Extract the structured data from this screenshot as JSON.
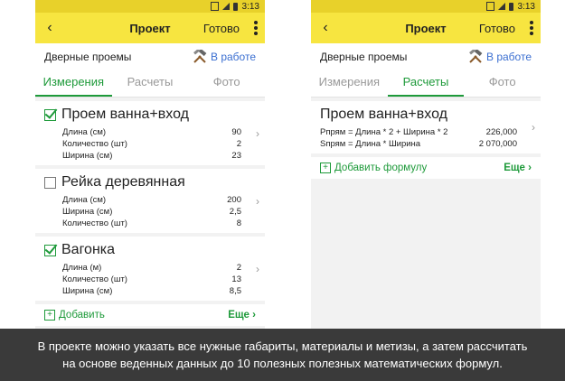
{
  "status_time": "3:13",
  "screens": [
    {
      "appbar": {
        "title": "Проект",
        "done_label": "Готово"
      },
      "subhead": {
        "project": "Дверные проемы",
        "status": "В работе"
      },
      "tabs": [
        {
          "label": "Измерения"
        },
        {
          "label": "Расчеты"
        },
        {
          "label": "Фото"
        }
      ],
      "active_tab": 0,
      "items": [
        {
          "title": "Проем ванна+вход",
          "checked": true,
          "rows": [
            {
              "label": "Длина (см)",
              "value": "90"
            },
            {
              "label": "Количество (шт)",
              "value": "2"
            },
            {
              "label": "Ширина (см)",
              "value": "23"
            }
          ]
        },
        {
          "title": "Рейка деревянная",
          "checked": false,
          "rows": [
            {
              "label": "Длина (см)",
              "value": "200"
            },
            {
              "label": "Ширина (см)",
              "value": "2,5"
            },
            {
              "label": "Количество (шт)",
              "value": "8"
            }
          ]
        },
        {
          "title": "Вагонка",
          "checked": true,
          "rows": [
            {
              "label": "Длина (м)",
              "value": "2"
            },
            {
              "label": "Количество (шт)",
              "value": "13"
            },
            {
              "label": "Ширина (см)",
              "value": "8,5"
            }
          ]
        }
      ],
      "footer": {
        "add_label": "Добавить",
        "more_label": "Еще"
      }
    },
    {
      "appbar": {
        "title": "Проект",
        "done_label": "Готово"
      },
      "subhead": {
        "project": "Дверные проемы",
        "status": "В работе"
      },
      "tabs": [
        {
          "label": "Измерения"
        },
        {
          "label": "Расчеты"
        },
        {
          "label": "Фото"
        }
      ],
      "active_tab": 1,
      "items": [
        {
          "title": "Проем ванна+вход",
          "rows": [
            {
              "label": "Pпрям = Длина * 2 + Ширина * 2",
              "value": "226,000"
            },
            {
              "label": "Sпрям = Длина * Ширина",
              "value": "2 070,000"
            }
          ]
        }
      ],
      "footer": {
        "add_label": "Добавить формулу",
        "more_label": "Еще"
      }
    }
  ],
  "caption": {
    "line1": "В проекте можно указать все нужные габариты, материалы и метизы, а затем рассчитать",
    "line2": "на основе веденных данных до 10 полезных полезных математических формул."
  }
}
